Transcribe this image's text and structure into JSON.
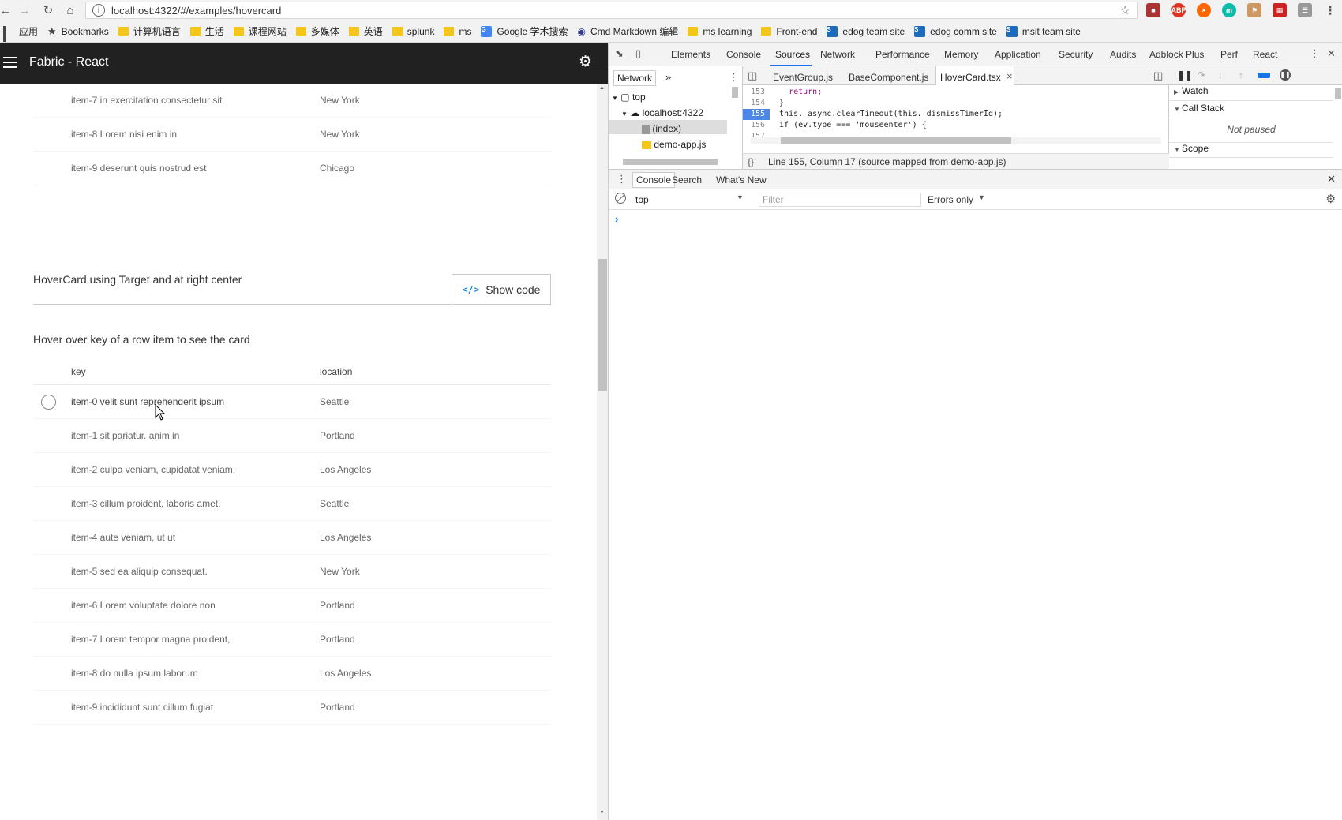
{
  "browser": {
    "url": "localhost:4322/#/examples/hovercard",
    "bookmarks": [
      {
        "label": "应用",
        "icon": "apps-icon"
      },
      {
        "label": "Bookmarks",
        "icon": "star-icon"
      },
      {
        "label": "计算机语言",
        "icon": "folder-icon"
      },
      {
        "label": "生活",
        "icon": "folder-icon"
      },
      {
        "label": "课程网站",
        "icon": "folder-icon"
      },
      {
        "label": "多媒体",
        "icon": "folder-icon"
      },
      {
        "label": "英语",
        "icon": "folder-icon"
      },
      {
        "label": "splunk",
        "icon": "folder-icon"
      },
      {
        "label": "ms",
        "icon": "folder-icon"
      },
      {
        "label": "Google 学术搜索",
        "icon": "google-scholar-icon"
      },
      {
        "label": "Cmd Markdown 编辑",
        "icon": "cmd-markdown-icon"
      },
      {
        "label": "ms learning",
        "icon": "folder-icon"
      },
      {
        "label": "Front-end",
        "icon": "folder-icon"
      },
      {
        "label": "edog team site",
        "icon": "sharepoint-icon"
      },
      {
        "label": "edog comm site",
        "icon": "sharepoint-icon"
      },
      {
        "label": "msit team site",
        "icon": "sharepoint-icon"
      }
    ]
  },
  "app": {
    "title": "Fabric - React"
  },
  "page": {
    "top_rows": [
      {
        "key": "item-7 in exercitation consectetur sit",
        "location": "New York"
      },
      {
        "key": "item-8 Lorem nisi enim in",
        "location": "New York"
      },
      {
        "key": "item-9 deserunt quis nostrud est",
        "location": "Chicago"
      }
    ],
    "section_title": "HoverCard using Target and at right center",
    "show_code_label": "Show code",
    "hint": "Hover over key of a row item to see the card",
    "columns": {
      "key": "key",
      "location": "location"
    },
    "rows": [
      {
        "key": "item-0 velit sunt reprehenderit ipsum",
        "location": "Seattle"
      },
      {
        "key": "item-1 sit pariatur. anim in",
        "location": "Portland"
      },
      {
        "key": "item-2 culpa veniam, cupidatat veniam,",
        "location": "Los Angeles"
      },
      {
        "key": "item-3 cillum proident, laboris amet,",
        "location": "Seattle"
      },
      {
        "key": "item-4 aute veniam, ut ut",
        "location": "Los Angeles"
      },
      {
        "key": "item-5 sed ea aliquip consequat.",
        "location": "New York"
      },
      {
        "key": "item-6 Lorem voluptate dolore non",
        "location": "Portland"
      },
      {
        "key": "item-7 Lorem tempor magna proident,",
        "location": "Portland"
      },
      {
        "key": "item-8 do nulla ipsum laborum",
        "location": "Los Angeles"
      },
      {
        "key": "item-9 incididunt sunt cillum fugiat",
        "location": "Portland"
      }
    ]
  },
  "devtools": {
    "tabs": [
      "Elements",
      "Console",
      "Sources",
      "Network",
      "Performance",
      "Memory",
      "Application",
      "Security",
      "Audits",
      "Adblock Plus",
      "Perf",
      "React"
    ],
    "active_tab": "Sources",
    "navigator": {
      "subtab": "Network",
      "more": "»",
      "tree": [
        "top",
        "localhost:4322",
        "(index)",
        "demo-app.js"
      ]
    },
    "files": [
      "EventGroup.js",
      "BaseComponent.js",
      "HoverCard.tsx"
    ],
    "active_file": "HoverCard.tsx",
    "code": [
      {
        "ln": "153",
        "text": "    return;"
      },
      {
        "ln": "154",
        "text": "  }"
      },
      {
        "ln": "155",
        "text": "  this._async.clearTimeout(this._dismissTimerId);"
      },
      {
        "ln": "156",
        "text": "  if (ev.type === 'mouseenter') {"
      },
      {
        "ln": "157",
        "text": ""
      }
    ],
    "status": "Line 155, Column 17   (source mapped from demo-app.js)",
    "status_braces": "{}",
    "debugger": {
      "watch": "Watch",
      "call_stack": "Call Stack",
      "not_paused": "Not paused",
      "scope": "Scope"
    },
    "drawer_tabs": [
      "Console",
      "Search",
      "What's New"
    ],
    "console": {
      "context": "top",
      "filter_placeholder": "Filter",
      "level": "Errors only"
    }
  }
}
